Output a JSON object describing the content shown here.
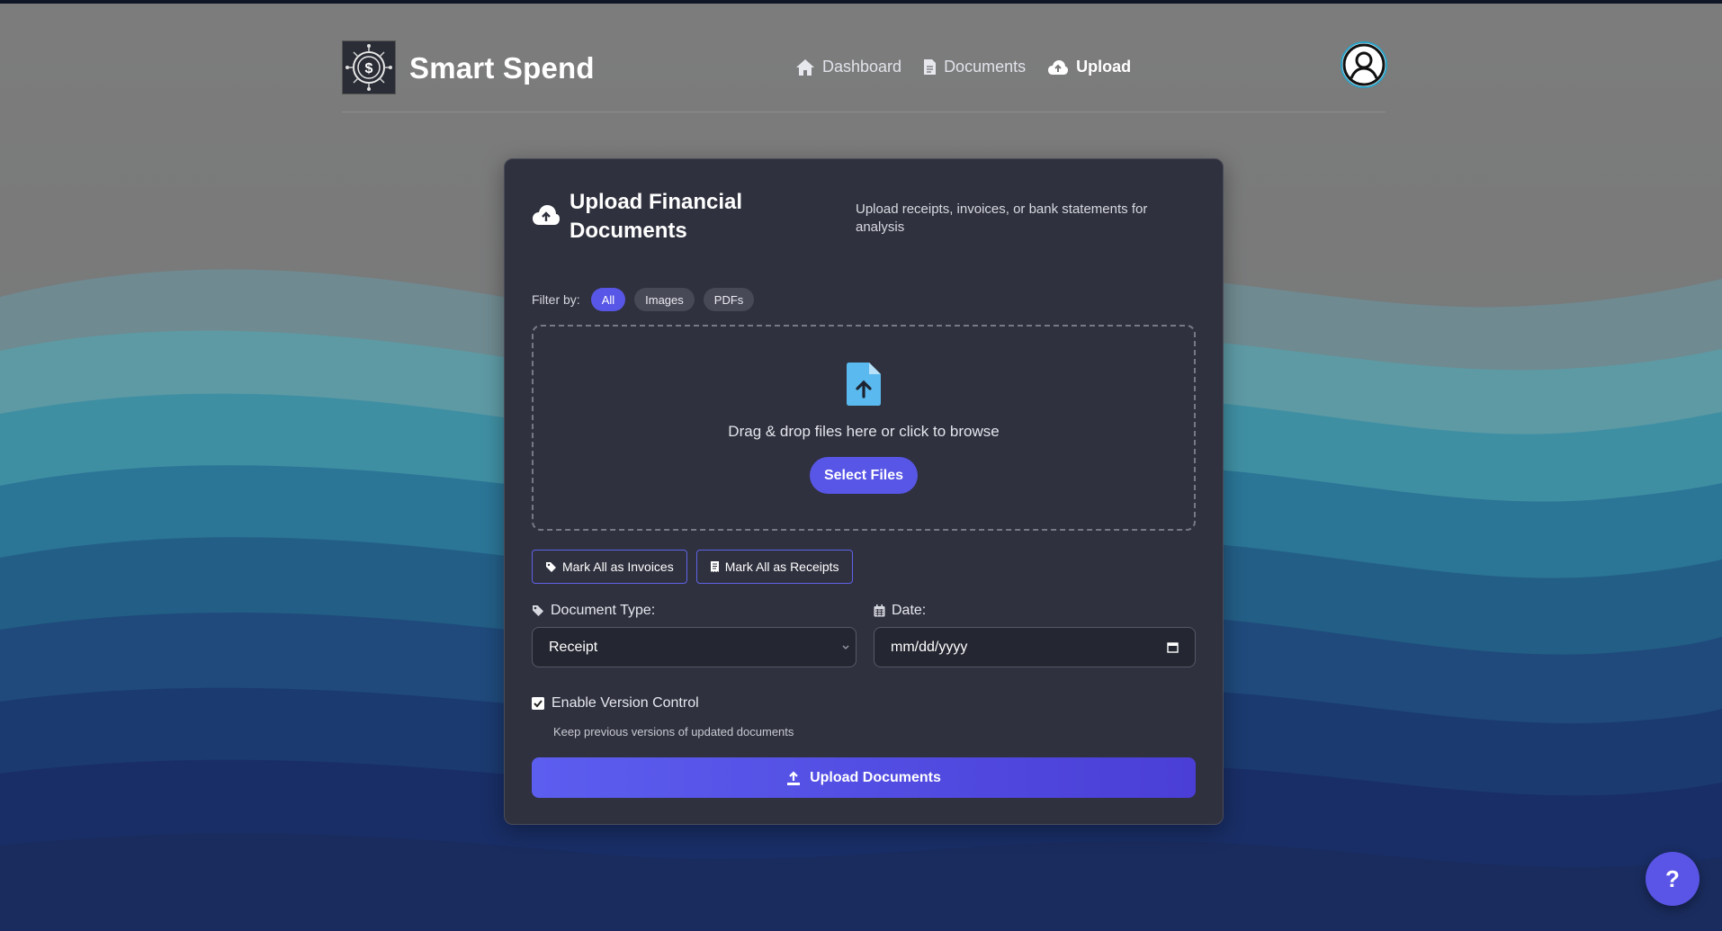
{
  "app": {
    "name": "Smart Spend"
  },
  "nav": {
    "items": [
      {
        "label": "Dashboard",
        "icon": "home-icon",
        "active": false
      },
      {
        "label": "Documents",
        "icon": "document-icon",
        "active": false
      },
      {
        "label": "Upload",
        "icon": "cloud-upload-icon",
        "active": true
      }
    ]
  },
  "upload_card": {
    "title": "Upload Financial Documents",
    "subtitle": "Upload receipts, invoices, or bank statements for analysis",
    "filter": {
      "label": "Filter by:",
      "options": [
        "All",
        "Images",
        "PDFs"
      ],
      "selected": "All"
    },
    "dropzone": {
      "text": "Drag & drop files here or click to browse",
      "button_label": "Select Files"
    },
    "mark_invoices_label": "Mark All as Invoices",
    "mark_receipts_label": "Mark All as Receipts",
    "document_type": {
      "label": "Document Type:",
      "value": "Receipt"
    },
    "date": {
      "label": "Date:",
      "placeholder": "mm/dd/yyyy"
    },
    "version_control": {
      "label": "Enable Version Control",
      "checked": true,
      "hint": "Keep previous versions of updated documents"
    },
    "upload_button_label": "Upload Documents"
  },
  "help": {
    "label": "?"
  },
  "colors": {
    "accent": "#5856e6",
    "card_bg": "#2f313e",
    "file_icon": "#5ab9ee"
  }
}
